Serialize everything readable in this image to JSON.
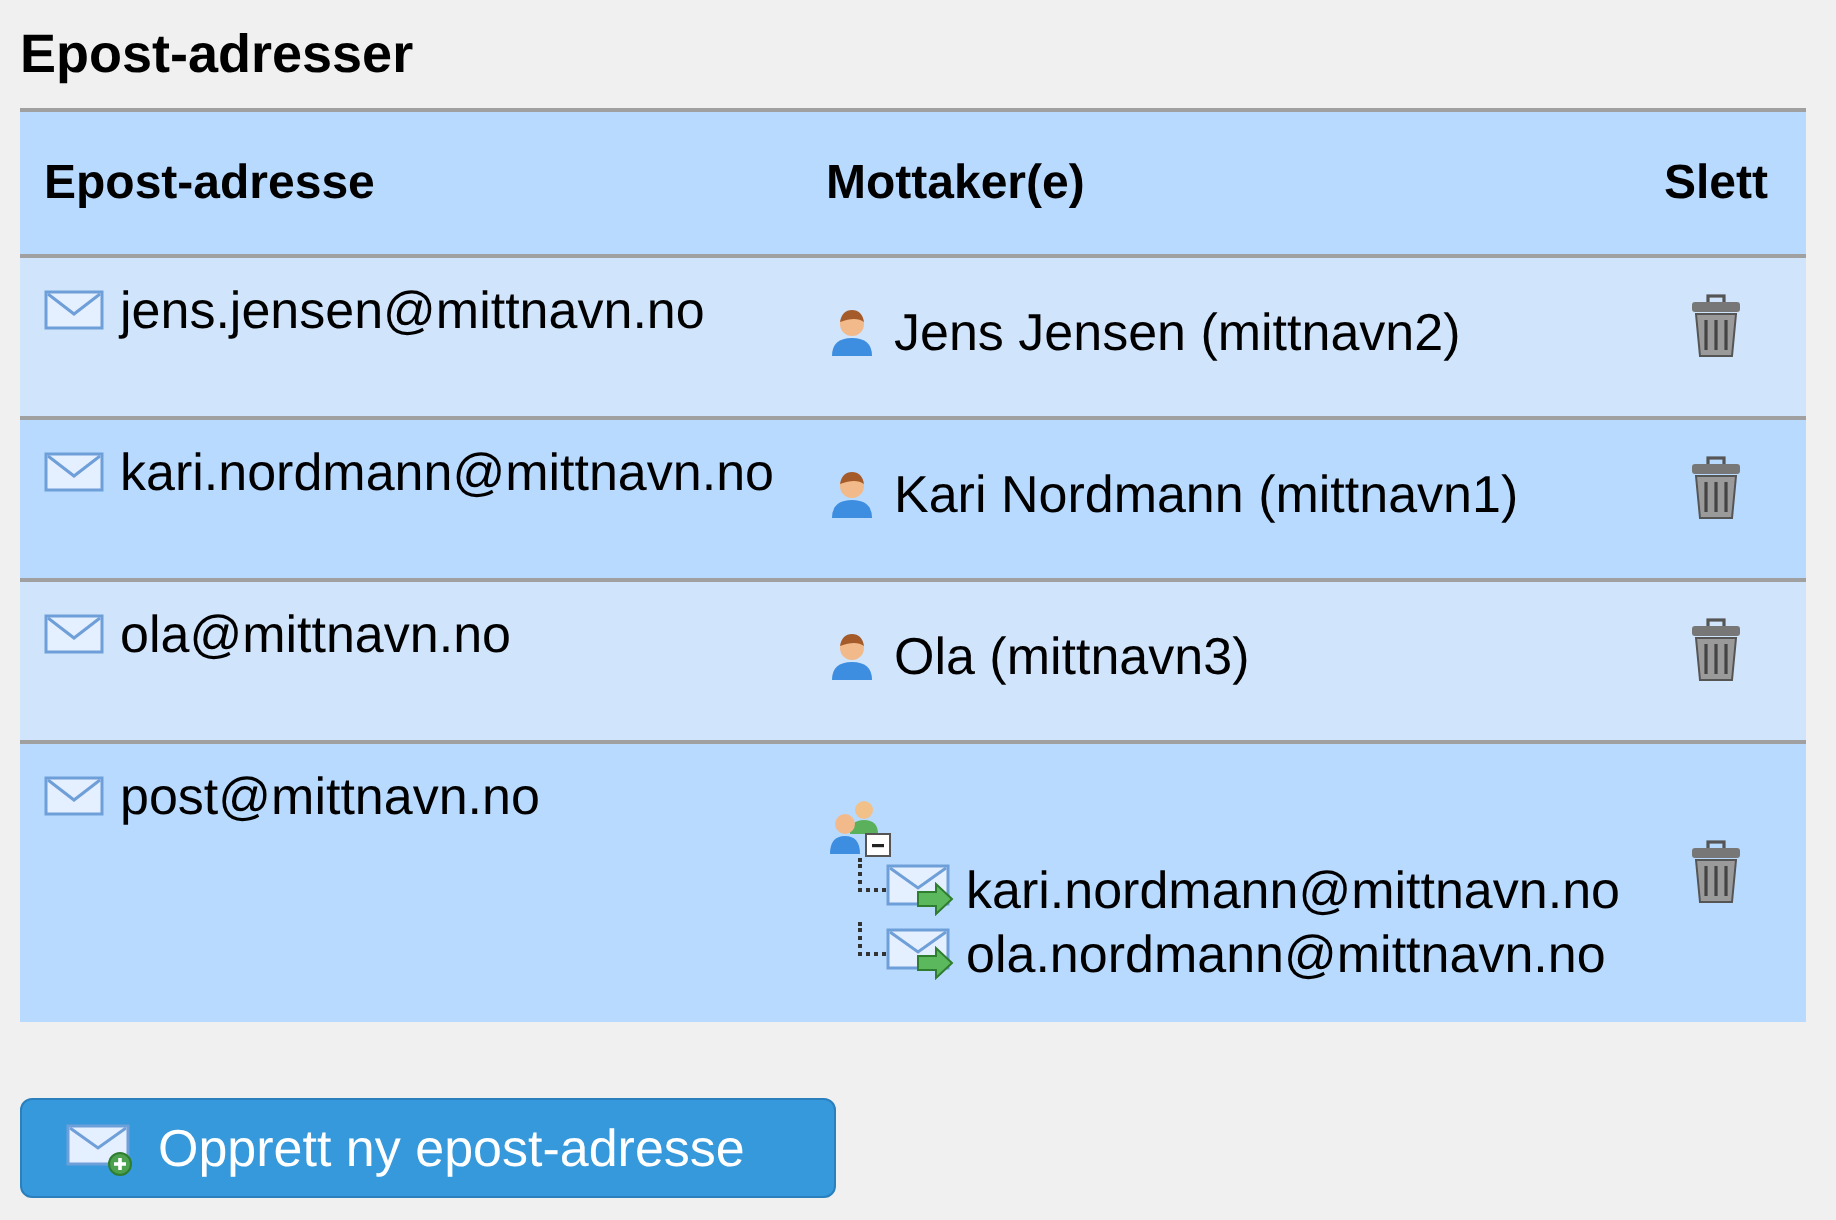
{
  "title": "Epost-adresser",
  "table": {
    "columns": [
      "Epost-adresse",
      "Mottaker(e)",
      "Slett"
    ],
    "rows": [
      {
        "address": "jens.jensen@mittnavn.no",
        "recipient": {
          "kind": "person",
          "label": "Jens Jensen (mittnavn2)"
        }
      },
      {
        "address": "kari.nordmann@mittnavn.no",
        "recipient": {
          "kind": "person",
          "label": "Kari Nordmann (mittnavn1)"
        }
      },
      {
        "address": "ola@mittnavn.no",
        "recipient": {
          "kind": "person",
          "label": "Ola (mittnavn3)"
        }
      },
      {
        "address": "post@mittnavn.no",
        "recipient": {
          "kind": "group",
          "expanded": true,
          "members": [
            "kari.nordmann@mittnavn.no",
            "ola.nordmann@mittnavn.no"
          ]
        }
      }
    ]
  },
  "button": "Opprett ny epost-adresse"
}
